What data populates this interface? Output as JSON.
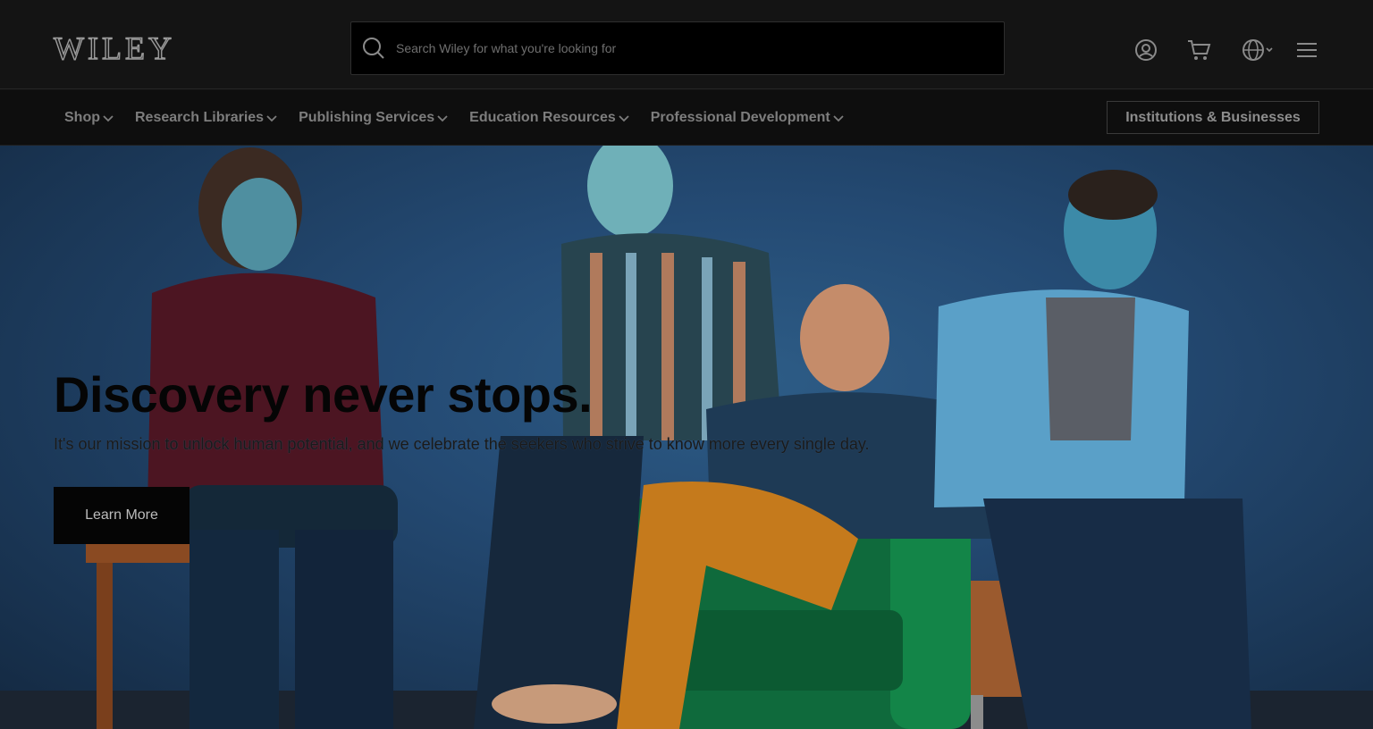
{
  "header": {
    "logo": "WILEY",
    "search": {
      "placeholder": "Search Wiley for what you're looking for",
      "value": ""
    },
    "icons": [
      "search-icon",
      "account-icon",
      "cart-icon",
      "globe-icon",
      "menu-icon"
    ]
  },
  "nav": {
    "items": [
      {
        "label": "Shop"
      },
      {
        "label": "Research Libraries"
      },
      {
        "label": "Publishing Services"
      },
      {
        "label": "Education Resources"
      },
      {
        "label": "Professional Development"
      }
    ],
    "institutions_label": "Institutions & Businesses"
  },
  "hero": {
    "title": "Discovery never stops.",
    "subtitle": "It's our mission to unlock human potential, and we celebrate the seekers who strive to know more every single day.",
    "cta_label": "Learn More"
  },
  "colors": {
    "header_bg": "#141414",
    "nav_bg": "#0e0e0e",
    "hero_wall": "#244a73",
    "chair_green": "#0f6a3c",
    "text_dark": "#050505"
  }
}
